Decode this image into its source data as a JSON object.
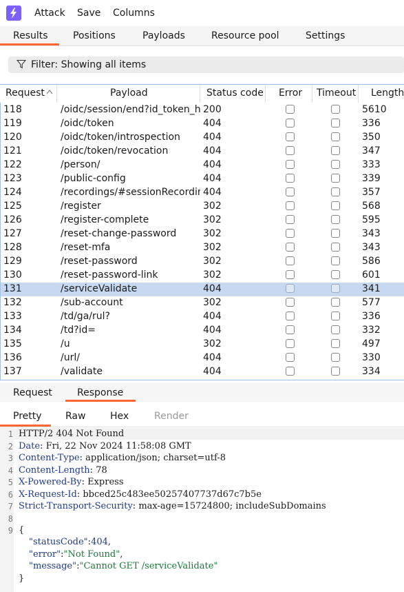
{
  "menu": {
    "items": [
      "Attack",
      "Save",
      "Columns"
    ]
  },
  "tabs": [
    "Results",
    "Positions",
    "Payloads",
    "Resource pool",
    "Settings"
  ],
  "filter": {
    "label": "Filter: Showing all items"
  },
  "table": {
    "columns": [
      "Request",
      "Payload",
      "Status code",
      "Error",
      "Timeout",
      "Length"
    ],
    "rows": [
      {
        "request": "118",
        "payload": "/oidc/session/end?id_token_hint",
        "status": "200",
        "length": "5610",
        "selected": false
      },
      {
        "request": "119",
        "payload": "/oidc/token",
        "status": "404",
        "length": "336",
        "selected": false
      },
      {
        "request": "120",
        "payload": "/oidc/token/introspection",
        "status": "404",
        "length": "350",
        "selected": false
      },
      {
        "request": "121",
        "payload": "/oidc/token/revocation",
        "status": "404",
        "length": "347",
        "selected": false
      },
      {
        "request": "122",
        "payload": "/person/",
        "status": "404",
        "length": "333",
        "selected": false
      },
      {
        "request": "123",
        "payload": "/public-config",
        "status": "404",
        "length": "339",
        "selected": false
      },
      {
        "request": "124",
        "payload": "/recordings/#sessionRecordings",
        "status": "404",
        "length": "357",
        "selected": false
      },
      {
        "request": "125",
        "payload": "/register",
        "status": "302",
        "length": "568",
        "selected": false
      },
      {
        "request": "126",
        "payload": "/register-complete",
        "status": "302",
        "length": "595",
        "selected": false
      },
      {
        "request": "127",
        "payload": "/reset-change-password",
        "status": "302",
        "length": "343",
        "selected": false
      },
      {
        "request": "128",
        "payload": "/reset-mfa",
        "status": "302",
        "length": "343",
        "selected": false
      },
      {
        "request": "129",
        "payload": "/reset-password",
        "status": "302",
        "length": "586",
        "selected": false
      },
      {
        "request": "130",
        "payload": "/reset-password-link",
        "status": "302",
        "length": "601",
        "selected": false
      },
      {
        "request": "131",
        "payload": "/serviceValidate",
        "status": "404",
        "length": "341",
        "selected": true
      },
      {
        "request": "132",
        "payload": "/sub-account",
        "status": "302",
        "length": "577",
        "selected": false
      },
      {
        "request": "133",
        "payload": "/td/ga/rul?",
        "status": "404",
        "length": "336",
        "selected": false
      },
      {
        "request": "134",
        "payload": "/td?id=",
        "status": "404",
        "length": "332",
        "selected": false
      },
      {
        "request": "135",
        "payload": "/u",
        "status": "302",
        "length": "497",
        "selected": false
      },
      {
        "request": "136",
        "payload": "/url/",
        "status": "404",
        "length": "330",
        "selected": false
      },
      {
        "request": "137",
        "payload": "/validate",
        "status": "404",
        "length": "334",
        "selected": false
      }
    ]
  },
  "detail": {
    "tabs": [
      "Request",
      "Response"
    ],
    "active_tab": "Response",
    "view_tabs": [
      "Pretty",
      "Raw",
      "Hex",
      "Render"
    ],
    "active_view": "Pretty",
    "response": {
      "status_line": "HTTP/2 404 Not Found",
      "headers": [
        {
          "name": "Date",
          "value": "Fri, 22 Nov 2024 11:58:08 GMT"
        },
        {
          "name": "Content-Type",
          "value": "application/json; charset=utf-8"
        },
        {
          "name": "Content-Length",
          "value": "78"
        },
        {
          "name": "X-Powered-By",
          "value": "Express"
        },
        {
          "name": "X-Request-Id",
          "value": "bbced25c483ee50257407737d67c7b5e"
        },
        {
          "name": "Strict-Transport-Security",
          "value": "max-age=15724800; includeSubDomains"
        }
      ],
      "body": {
        "open": "{",
        "fields": [
          {
            "key": "\"statusCode\"",
            "value": "404",
            "type": "num",
            "comma": ","
          },
          {
            "key": "\"error\"",
            "value": "\"Not Found\"",
            "type": "str",
            "comma": ","
          },
          {
            "key": "\"message\"",
            "value": "\"Cannot GET /serviceValidate\"",
            "type": "str",
            "comma": ""
          }
        ],
        "close": "}"
      }
    },
    "line_numbers": [
      "1",
      "2",
      "3",
      "4",
      "5",
      "6",
      "7",
      "8",
      "9"
    ]
  },
  "colors": {
    "accent": "#ff6633",
    "selection": "#c7d9f0",
    "logo": "#7b61ff"
  }
}
